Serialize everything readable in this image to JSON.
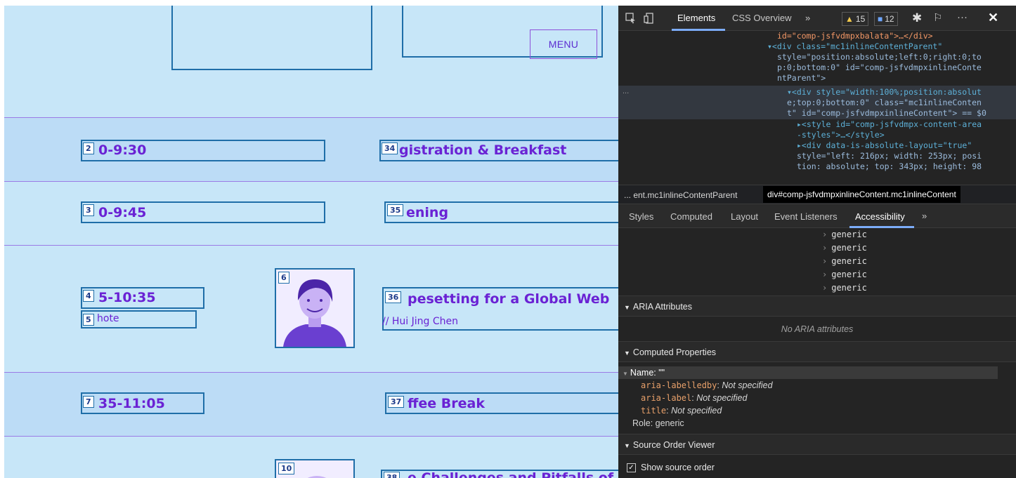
{
  "page": {
    "menu_label": "MENU",
    "rows": [
      {
        "time_badge": "2",
        "time": "0-9:30",
        "title_badge": "34",
        "title": "gistration & Breakfast"
      },
      {
        "time_badge": "3",
        "time": "0-9:45",
        "title_badge": "35",
        "title": "ening"
      },
      {
        "time_badge": "4",
        "time": "5-10:35",
        "title_badge": "36",
        "title": "pesetting for a Global Web",
        "subtitle": "// Hui Jing Chen",
        "type_badge": "5",
        "type": "hote",
        "photo_badge": "6"
      },
      {
        "time_badge": "7",
        "time": "35-11:05",
        "title_badge": "37",
        "title": "ffee Break"
      },
      {
        "photo_badge": "10",
        "title_badge": "38",
        "title": "e Challenges and Pitfalls of"
      }
    ]
  },
  "devtools": {
    "tabs": [
      "Elements",
      "CSS Overview",
      "»"
    ],
    "warnings": "15",
    "messages": "12",
    "elements_code": [
      "id=\"comp-jsfvdmpxbalata\">…</div>",
      "▾<div class=\"mc1inlineContentParent\"",
      "style=\"position:absolute;left:0;right:0;to",
      "p:0;bottom:0\" id=\"comp-jsfvdmpxinlineConte",
      "ntParent\">",
      "▾<div style=\"width:100%;position:absolut",
      "e;top:0;bottom:0\" class=\"mc1inlineConten",
      "t\" id=\"comp-jsfvdmpxinlineContent\"> == $0",
      "▸<style id=\"comp-jsfvdmpx-content-area",
      "-styles\">…</style>",
      "▸<div data-is-absolute-layout=\"true\"",
      "style=\"left: 216px; width: 253px; posi",
      "tion: absolute; top: 343px; height: 98"
    ],
    "breadcrumbs": [
      "... ent.mc1inlineContentParent",
      "div#comp-jsfvdmpxinlineContent.mc1inlineContent"
    ],
    "subtabs": [
      "Styles",
      "Computed",
      "Layout",
      "Event Listeners",
      "Accessibility",
      "»"
    ],
    "tree_items": [
      "generic",
      "generic",
      "generic",
      "generic",
      "generic"
    ],
    "aria_title": "ARIA Attributes",
    "aria_empty": "No ARIA attributes",
    "computed_title": "Computed Properties",
    "name_row": "Name: \"\"",
    "props": [
      {
        "k": "aria-labelledby",
        "v": "Not specified"
      },
      {
        "k": "aria-label",
        "v": "Not specified"
      },
      {
        "k": "title",
        "v": "Not specified"
      }
    ],
    "role_row": "Role: generic",
    "source_order_title": "Source Order Viewer",
    "show_source_order": "Show source order"
  },
  "colors": {
    "accent": "#6a22d4",
    "overlay_border": "#1f6ea8",
    "devtools_bg": "#242424"
  }
}
